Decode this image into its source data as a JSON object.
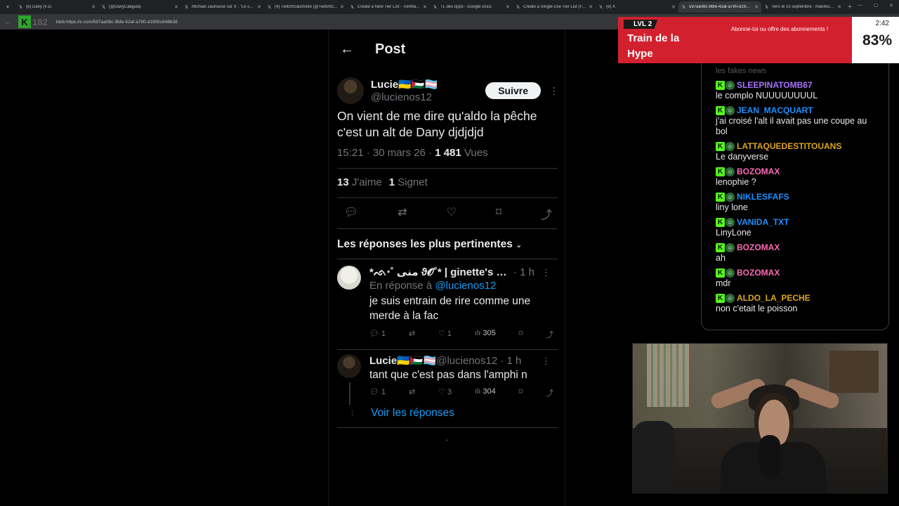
{
  "browser": {
    "tabs": [
      {
        "title": "(6) Dany (F.D.",
        "active": false
      },
      {
        "title": "(@DanyCaligula)",
        "active": false
      },
      {
        "title": "Michael Jaunasse sur X : \"Le s...",
        "active": false
      },
      {
        "title": "(4) TwitchGauchiste (@TwitchG...",
        "active": false
      },
      {
        "title": "Create a New Tier List - TierMa...",
        "active": false
      },
      {
        "title": "TL des opps - Google Docs",
        "active": false
      },
      {
        "title": "Create a Single-Use Tier List (F...",
        "active": false
      },
      {
        "title": "(6) X",
        "active": false
      },
      {
        "title": "597aa08c-9bfe-42af-a790-d19...",
        "active": true
      },
      {
        "title": "Vers le 10 septembre : manifes...",
        "active": false
      }
    ],
    "url": "blob:https://x.com/597aa08c-9bfe-42af-a790-d1900c648b38",
    "logo_number": "182"
  },
  "post": {
    "header_title": "Post",
    "author_name": "Lucie🇺🇦🇵🇸🏳️‍⚧️",
    "author_handle": "@lucienos12",
    "follow_label": "Suivre",
    "text": "On vient de me dire qu'aldo la pêche c'est un alt de Dany djdjdjd",
    "time": "15:21 · 30 mars 26 · ",
    "views_count": "1 481",
    "views_label": " Vues",
    "likes_count": "13",
    "likes_label": " J'aime",
    "bookmarks_count": "1",
    "bookmarks_label": " Signet",
    "replies_title": "Les réponses les plus pertinentes"
  },
  "replies": [
    {
      "name": "*ᨒ‧˚ منى ϑ𝓞˚*  | ginette's mo...",
      "time": " · 1 h",
      "sub_prefix": "En réponse à ",
      "mention": "@lucienos12",
      "text": "je suis entrain de rire comme une merde à la fac",
      "replies": "1",
      "likes": "1",
      "views": "305"
    },
    {
      "name": "Lucie🇺🇦🇵🇸🏳️‍⚧️",
      "handle": " @lucienos12 · 1 h",
      "text": "tant que c'est pas dans l'amphi n",
      "replies": "1",
      "likes": "3",
      "views": "304"
    }
  ],
  "voir_reponses": "Voir les réponses",
  "hype_train": {
    "level": "LVL 2",
    "title": "Train de la Hype",
    "subtitle": "Abonne-toi ou offre des abonnements !",
    "time": "2:42",
    "percent": "83%"
  },
  "chat": {
    "faded_line": "les fakes news",
    "messages": [
      {
        "user": "SLEEPINATOMB67",
        "color": "#a970ff",
        "text": "le complo NUUUUUUUUL"
      },
      {
        "user": "JEAN_MACQUART",
        "color": "#1e90ff",
        "text": "j'ai croisé l'alt il avait pas une coupe au bol"
      },
      {
        "user": "LATTAQUEDESTITOUANS",
        "color": "#daa520",
        "text": "Le danyverse"
      },
      {
        "user": "BOZOMAX",
        "color": "#ff69b4",
        "text": "lenophie ?"
      },
      {
        "user": "NIKLESFAFS",
        "color": "#1e90ff",
        "text": "liny lone"
      },
      {
        "user": "VANIDA_TXT",
        "color": "#1e90ff",
        "text": "LinyLone"
      },
      {
        "user": "BOZOMAX",
        "color": "#ff69b4",
        "text": "ah"
      },
      {
        "user": "BOZOMAX",
        "color": "#ff69b4",
        "text": "mdr"
      },
      {
        "user": "ALDO_LA_PECHE",
        "color": "#daa520",
        "text": "non c'etait le poisson"
      }
    ]
  }
}
